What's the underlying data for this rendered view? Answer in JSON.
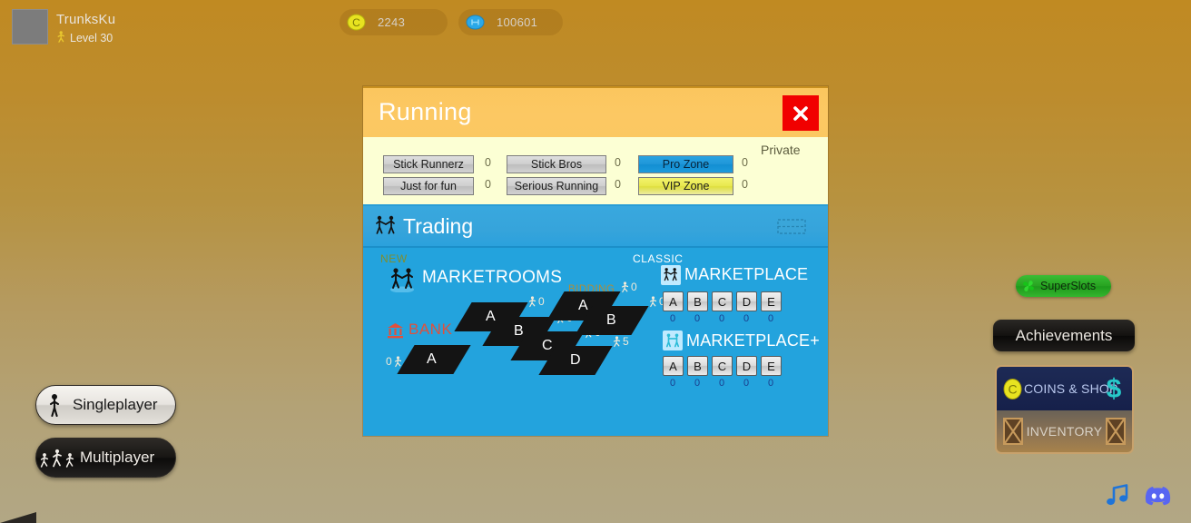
{
  "topbar": {
    "avatar": "avatar-placeholder",
    "player_name": "TrunksKu",
    "level_label": "Level 30",
    "currencies": [
      {
        "icon": "coin-icon",
        "value": "2243"
      },
      {
        "icon": "gem-icon",
        "value": "100601"
      }
    ]
  },
  "modal": {
    "title": "Running",
    "close_label": "✕",
    "rooms": {
      "private_label": "Private",
      "items": [
        {
          "label": "Stick Runnerz",
          "count": "0",
          "style": "grey"
        },
        {
          "label": "Just for fun",
          "count": "0",
          "style": "grey"
        },
        {
          "label": "Stick Bros",
          "count": "0",
          "style": "grey"
        },
        {
          "label": "Serious Running",
          "count": "0",
          "style": "grey"
        },
        {
          "label": "Pro Zone",
          "count": "0",
          "style": "blue"
        },
        {
          "label": "VIP Zone",
          "count": "0",
          "style": "yellow"
        }
      ]
    },
    "trading": {
      "title": "Trading",
      "icon": "handshake-icon",
      "grid_icon": "dashed-grid-icon"
    },
    "marketrooms": {
      "tag": "NEW",
      "title": "MARKETROOMS",
      "icon": "handshake-icon",
      "bidding_label": "BIDDING",
      "bank_label": "BANK",
      "bank_icon": "bank-icon",
      "tiles": [
        {
          "letter": "A",
          "count": "0"
        },
        {
          "letter": "A",
          "count": "0"
        },
        {
          "letter": "B",
          "count": "0"
        },
        {
          "letter": "C",
          "count": "0"
        },
        {
          "letter": "D",
          "count": "5"
        },
        {
          "letter": "A",
          "count": "0"
        },
        {
          "letter": "B",
          "count": "0"
        }
      ]
    },
    "marketplace": {
      "tag": "CLASSIC",
      "title": "MARKETPLACE",
      "icon": "handshake-icon",
      "slots": [
        {
          "letter": "A",
          "count": "0"
        },
        {
          "letter": "B",
          "count": "0"
        },
        {
          "letter": "C",
          "count": "0"
        },
        {
          "letter": "D",
          "count": "0"
        },
        {
          "letter": "E",
          "count": "0"
        }
      ]
    },
    "marketplace_plus": {
      "title": "MARKETPLACE+",
      "icon": "marketplace-plus-icon",
      "slots": [
        {
          "letter": "A",
          "count": "0"
        },
        {
          "letter": "B",
          "count": "0"
        },
        {
          "letter": "C",
          "count": "0"
        },
        {
          "letter": "D",
          "count": "0"
        },
        {
          "letter": "E",
          "count": "0"
        }
      ]
    }
  },
  "left_menu": {
    "singleplayer": {
      "label": "Singleplayer",
      "icon": "stick-figure-icon"
    },
    "multiplayer": {
      "label": "Multiplayer",
      "icon": "three-stick-figures-icon"
    }
  },
  "right_menu": {
    "superslots": {
      "label": "SuperSlots",
      "icon": "clover-icon"
    },
    "achievements": {
      "label": "Achievements"
    },
    "coins_shop": {
      "label": "COINS & SHOP",
      "icon": "coin-icon",
      "icon2": "dollar-icon"
    },
    "inventory": {
      "label": "INVENTORY",
      "icon": "crate-icon"
    }
  },
  "bottom_bar": {
    "music": "music-note-icon",
    "discord": "discord-icon"
  },
  "colors": {
    "background_top": "#c08a22",
    "background_bottom": "#b2a785",
    "modal_header": "#fbc65e",
    "modal_body": "#23a3dd",
    "close_red": "#f10000",
    "rooms_bg": "#fcffd4",
    "pro_zone_blue": "#1f96d8",
    "vip_zone_yellow": "#e8e84e",
    "superslots_green": "#27a321",
    "bank_red": "#e0503c",
    "bidding_gold": "#b08c36"
  }
}
